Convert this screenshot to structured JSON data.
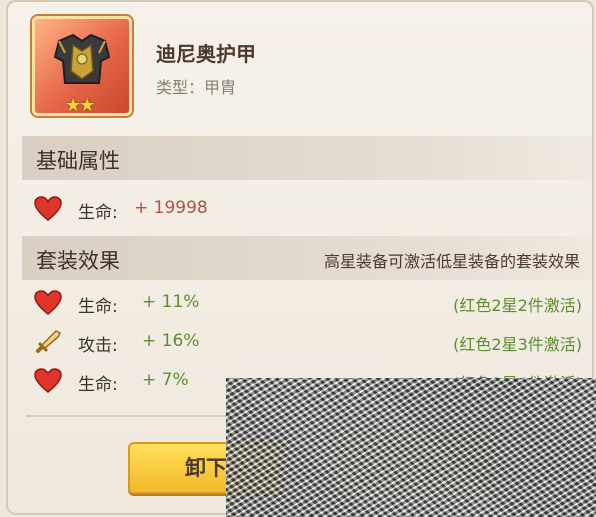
{
  "item": {
    "name": "迪尼奥护甲",
    "type_label": "类型：甲胄",
    "star_count": 2
  },
  "base_section": {
    "title": "基础属性",
    "stats": [
      {
        "icon": "heart-icon",
        "label": "生命:",
        "value": "+ 19998"
      }
    ]
  },
  "set_section": {
    "title": "套装效果",
    "note": "高星装备可激活低星装备的套装效果",
    "stats": [
      {
        "icon": "heart-icon",
        "label": "生命:",
        "value": "+ 11%",
        "condition": "(红色2星2件激活)"
      },
      {
        "icon": "sword-icon",
        "label": "攻击:",
        "value": "+ 16%",
        "condition": "(红色2星3件激活)"
      },
      {
        "icon": "heart-icon",
        "label": "生命:",
        "value": "+ 7%",
        "condition": "(红色1星4件激活)"
      }
    ]
  },
  "actions": {
    "unequip_label": "卸下"
  },
  "colors": {
    "accent_yellow": "#f2b92a",
    "value_red": "#b0533c",
    "value_green": "#5a8f2e"
  }
}
